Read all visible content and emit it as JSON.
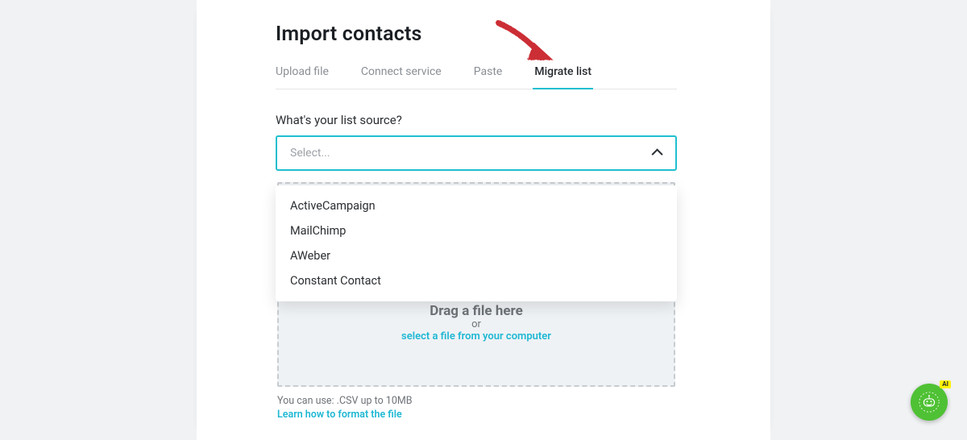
{
  "title": "Import contacts",
  "tabs": [
    {
      "label": "Upload file",
      "active": false
    },
    {
      "label": "Connect service",
      "active": false
    },
    {
      "label": "Paste",
      "active": false
    },
    {
      "label": "Migrate list",
      "active": true
    }
  ],
  "source_section": {
    "label": "What's your list source?",
    "placeholder": "Select...",
    "options": [
      "ActiveCampaign",
      "MailChimp",
      "AWeber",
      "Constant Contact"
    ]
  },
  "dropzone": {
    "drag_text": "Drag a file here",
    "or_text": "or",
    "select_link": "select a file from your computer"
  },
  "hints": {
    "usage": "You can use: .CSV up to 10MB",
    "format_link": "Learn how to format the file"
  },
  "chat": {
    "badge": "AI"
  },
  "colors": {
    "accent": "#1fbfcf",
    "link": "#1fb8d3",
    "text": "#2b2f33",
    "muted": "#8a8f95",
    "drop_bg": "#eff2f5",
    "fab": "#4fc134",
    "badge": "#fff200",
    "arrow": "#cc2d36"
  }
}
